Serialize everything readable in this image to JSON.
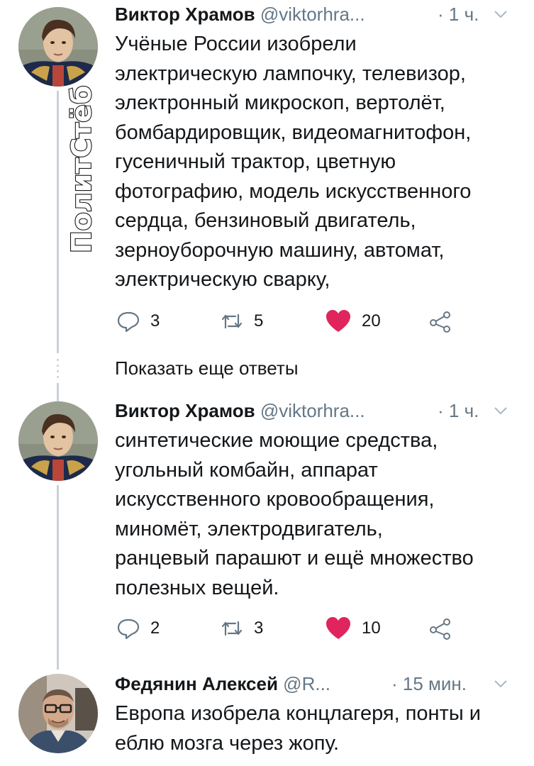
{
  "tweets": [
    {
      "author": "Виктор Храмов",
      "handle": "@viktorhra...",
      "time": "· 1 ч.",
      "lines": [
        "Учёные России изобрели",
        "электрическую лампочку, телевизор,",
        "электронный микроскоп, вертолёт,",
        "бомбардировщик, видеомагнитофон,",
        "гусеничный трактор, цветную",
        "фотографию, модель искусственного",
        "сердца, бензиновый двигатель,",
        "зерноуборочную машину, автомат,",
        "электрическую сварку,"
      ],
      "replies": "3",
      "retweets": "5",
      "likes": "20"
    },
    {
      "author": "Виктор Храмов",
      "handle": "@viktorhra...",
      "time": "· 1 ч.",
      "lines": [
        "синтетические моющие средства,",
        "угольный комбайн, аппарат",
        "искусственного кровообращения,",
        "миномёт, электродвигатель,",
        "ранцевый парашют и ещё множество",
        "полезных вещей."
      ],
      "replies": "2",
      "retweets": "3",
      "likes": "10"
    },
    {
      "author": "Федянин Алексей",
      "handle": "@R...",
      "time": "· 15 мин.",
      "lines": [
        "Европа изобрела концлагеря, понты и",
        "еблю мозга через жопу."
      ]
    }
  ],
  "show_more_label": "Показать еще ответы",
  "watermark": "ПолитСтёб",
  "colors": {
    "like": "#e0245e",
    "secondary": "#657786",
    "thread": "#c8d1d8"
  },
  "icons": [
    "reply-icon",
    "retweet-icon",
    "heart-icon",
    "share-icon",
    "chevron-down-icon"
  ]
}
